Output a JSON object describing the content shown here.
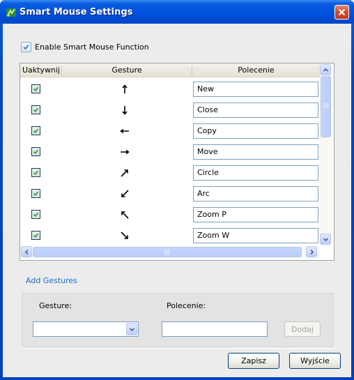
{
  "window": {
    "title": "Smart Mouse Settings",
    "icon": "app-gesture-icon",
    "close_icon": "close-icon"
  },
  "enable": {
    "label": "Enable Smart Mouse Function",
    "checked": true
  },
  "grid": {
    "columns": [
      "Uaktywnij",
      "Gesture",
      "Polecenie"
    ],
    "rows": [
      {
        "enabled": true,
        "gesture": "arrow-up",
        "command": "New"
      },
      {
        "enabled": true,
        "gesture": "arrow-down",
        "command": "Close"
      },
      {
        "enabled": true,
        "gesture": "arrow-left",
        "command": "Copy"
      },
      {
        "enabled": true,
        "gesture": "arrow-right",
        "command": "Move"
      },
      {
        "enabled": true,
        "gesture": "arrow-up-right",
        "command": "Circle"
      },
      {
        "enabled": true,
        "gesture": "arrow-down-left",
        "command": "Arc"
      },
      {
        "enabled": true,
        "gesture": "arrow-up-left",
        "command": "Zoom P"
      },
      {
        "enabled": true,
        "gesture": "arrow-down-right",
        "command": "Zoom W"
      }
    ]
  },
  "add_gestures": {
    "title": "Add Gestures",
    "gesture_label": "Gesture:",
    "gesture_value": "",
    "command_label": "Polecenie:",
    "command_value": "",
    "add_button": "Dodaj"
  },
  "footer": {
    "save_button": "Zapisz",
    "exit_button": "Wyjście"
  }
}
